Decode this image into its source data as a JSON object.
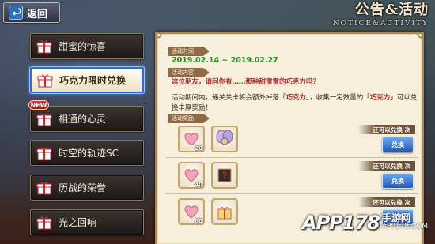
{
  "header": {
    "back_label": "返回",
    "title": "公告&活动",
    "subtitle": "NOTICE&ACTIVITY"
  },
  "sidebar": {
    "items": [
      {
        "label": "甜蜜的惊喜"
      },
      {
        "label": "巧克力限时兑换",
        "active": true
      },
      {
        "label": "相通的心灵",
        "badge": "NEW"
      },
      {
        "label": "时空的轨迹SC"
      },
      {
        "label": "历战的荣誉"
      },
      {
        "label": "光之回响"
      }
    ]
  },
  "main": {
    "time_label": "活动时间",
    "date_range": "2019.02.14 ~ 2019.02.27",
    "content_label": "活动内容",
    "question": "这位朋友，请问你有……那种甜蜜蜜的巧克力吗？",
    "desc_part1": "活动期间内，通关关卡将会额外掉落「",
    "desc_hl1": "巧克力",
    "desc_part2": "」，收集一定数量的「",
    "desc_hl2": "巧克力",
    "desc_part3": "」可以兑换丰厚奖励！",
    "reward_label": "活动奖励",
    "rewards": [
      {
        "cost_count": "20",
        "exchange_label": "还可以兑换 次",
        "button_label": "兑换"
      },
      {
        "cost_count": "40",
        "exchange_label": "还可以兑换 次",
        "button_label": "兑换"
      },
      {
        "cost_count": "60",
        "exchange_label": "还可以兑换 次",
        "button_label": "兑换"
      }
    ]
  },
  "watermark": {
    "brand": "APP178",
    "domain": "手游网",
    "url": "APP178.COM"
  }
}
